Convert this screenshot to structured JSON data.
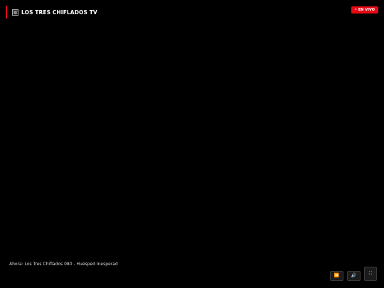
{
  "header": {
    "icon": "film-frames-icon",
    "title": "LOS TRES CHIFLADOS TV"
  },
  "badge": {
    "dot": "•",
    "label": "EN VIVO",
    "color": "#e50914"
  },
  "now_playing": {
    "text": "Ahora: Los Tres Chiflados 080 - Huésped Inesperad"
  },
  "controls": {
    "rewind_icon": "⏪",
    "volume_icon": "🔊",
    "fullscreen_icon": "⛶"
  },
  "colors": {
    "background": "#000000",
    "accent": "#e50914"
  }
}
